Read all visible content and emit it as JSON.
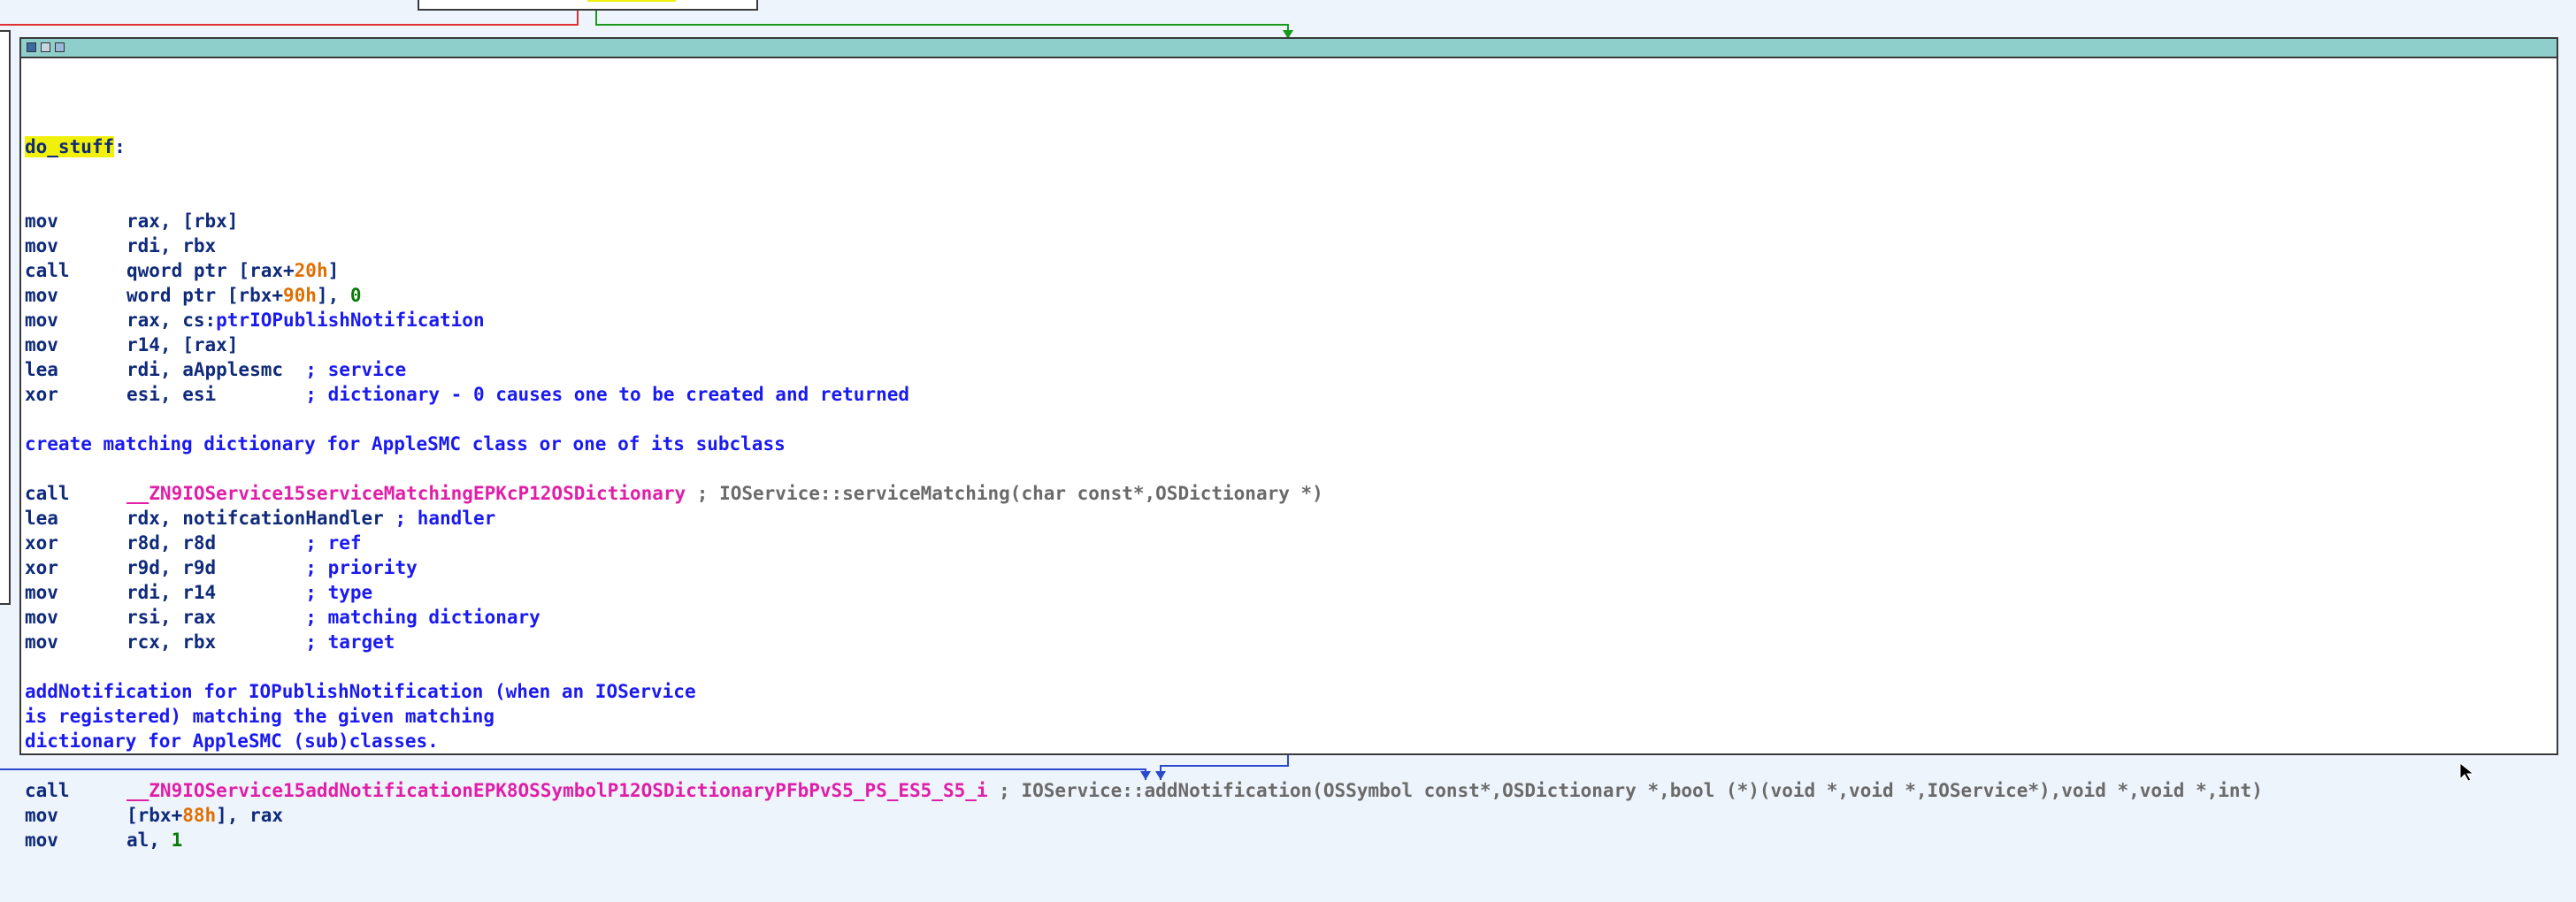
{
  "function_block": {
    "label": "do_stuff",
    "lines": [
      {
        "mn": "mov",
        "ops": [
          {
            "t": "rax, [rbx]",
            "c": "op"
          }
        ]
      },
      {
        "mn": "mov",
        "ops": [
          {
            "t": "rdi, rbx",
            "c": "op"
          }
        ]
      },
      {
        "mn": "call",
        "ops": [
          {
            "t": "qword ptr [rax+",
            "c": "op"
          },
          {
            "t": "20h",
            "c": "num"
          },
          {
            "t": "]",
            "c": "op"
          }
        ]
      },
      {
        "mn": "mov",
        "ops": [
          {
            "t": "word ptr [rbx+",
            "c": "op"
          },
          {
            "t": "90h",
            "c": "num"
          },
          {
            "t": "], ",
            "c": "op"
          },
          {
            "t": "0",
            "c": "zero"
          }
        ]
      },
      {
        "mn": "mov",
        "ops": [
          {
            "t": "rax, cs:",
            "c": "op"
          },
          {
            "t": "ptrIOPublishNotification",
            "c": "cmt"
          }
        ]
      },
      {
        "mn": "mov",
        "ops": [
          {
            "t": "r14, [rax]",
            "c": "op"
          }
        ]
      },
      {
        "mn": "lea",
        "ops": [
          {
            "t": "rdi, aApplesmc  ",
            "c": "op"
          },
          {
            "t": "; service",
            "c": "cmt"
          }
        ]
      },
      {
        "mn": "xor",
        "ops": [
          {
            "t": "esi, esi        ",
            "c": "op"
          },
          {
            "t": "; dictionary - 0 causes one to be created and returned",
            "c": "cmt"
          }
        ]
      },
      {
        "blank": true
      },
      {
        "comment": "create matching dictionary for AppleSMC class or one of its subclass"
      },
      {
        "blank": true
      },
      {
        "mn": "call",
        "ops": [
          {
            "t": "__ZN9IOService15serviceMatchingEPKcP12OSDictionary",
            "c": "fn"
          },
          {
            "t": " ; IOService::serviceMatching(char const*,OSDictionary *)",
            "c": "acmt"
          }
        ]
      },
      {
        "mn": "lea",
        "ops": [
          {
            "t": "rdx, notifcationHandler ",
            "c": "op"
          },
          {
            "t": "; handler",
            "c": "cmt"
          }
        ]
      },
      {
        "mn": "xor",
        "ops": [
          {
            "t": "r8d, r8d        ",
            "c": "op"
          },
          {
            "t": "; ref",
            "c": "cmt"
          }
        ]
      },
      {
        "mn": "xor",
        "ops": [
          {
            "t": "r9d, r9d        ",
            "c": "op"
          },
          {
            "t": "; priority",
            "c": "cmt"
          }
        ]
      },
      {
        "mn": "mov",
        "ops": [
          {
            "t": "rdi, r14        ",
            "c": "op"
          },
          {
            "t": "; type",
            "c": "cmt"
          }
        ]
      },
      {
        "mn": "mov",
        "ops": [
          {
            "t": "rsi, rax        ",
            "c": "op"
          },
          {
            "t": "; matching dictionary",
            "c": "cmt"
          }
        ]
      },
      {
        "mn": "mov",
        "ops": [
          {
            "t": "rcx, rbx        ",
            "c": "op"
          },
          {
            "t": "; target",
            "c": "cmt"
          }
        ]
      },
      {
        "blank": true
      },
      {
        "comment": "addNotification for IOPublishNotification (when an IOService"
      },
      {
        "comment": "is registered) matching the given matching"
      },
      {
        "comment": "dictionary for AppleSMC (sub)classes."
      },
      {
        "blank": true
      },
      {
        "mn": "call",
        "ops": [
          {
            "t": "__ZN9IOService15addNotificationEPK8OSSymbolP12OSDictionaryPFbPvS5_PS_ES5_S5_i",
            "c": "fn"
          },
          {
            "t": " ; IOService::addNotification(OSSymbol const*,OSDictionary *,bool (*)(void *,void *,IOService*),void *,void *,int)",
            "c": "acmt"
          }
        ]
      },
      {
        "mn": "mov",
        "ops": [
          {
            "t": "[rbx+",
            "c": "op"
          },
          {
            "t": "88h",
            "c": "num"
          },
          {
            "t": "], rax",
            "c": "op"
          }
        ]
      },
      {
        "mn": "mov",
        "ops": [
          {
            "t": "al, ",
            "c": "op"
          },
          {
            "t": "1",
            "c": "zero"
          }
        ]
      }
    ]
  },
  "colors": {
    "background": "#eef4fb",
    "titlebar": "#8fcfcb",
    "mnemonic": "#0f2a7a",
    "number": "#e06e00",
    "immediate": "#0a7a0a",
    "function": "#e01ea8",
    "comment": "#1a1af0",
    "auto_comment": "#6a6a6a",
    "highlight": "#f0f00a",
    "edge_red": "#e03030",
    "edge_green": "#1a9a1a",
    "edge_blue": "#2a4acc"
  },
  "icons": [
    "graph-block-icon",
    "edit-block-icon",
    "info-block-icon",
    "mouse-cursor-icon"
  ]
}
